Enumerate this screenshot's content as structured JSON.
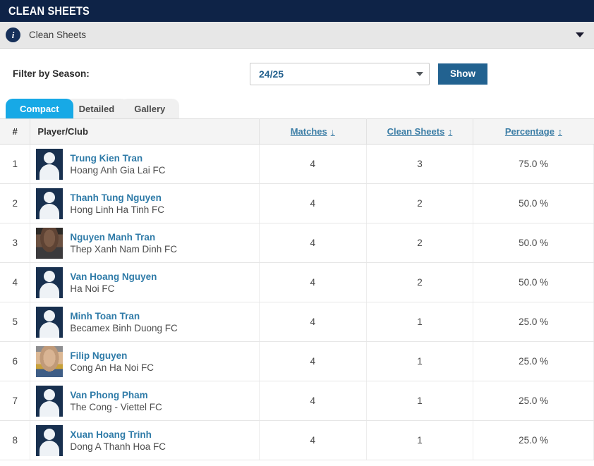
{
  "titlebar": {
    "title": "Clean Sheets"
  },
  "infobar": {
    "label": "Clean Sheets",
    "info_icon": "info-icon",
    "chevron_icon": "chevron-down-icon"
  },
  "filter": {
    "label": "Filter by Season:",
    "season_value": "24/25",
    "season_options": [
      "24/25"
    ],
    "show_label": "Show",
    "caret_icon": "caret-down-icon",
    "button_color": "#226290"
  },
  "tabs": [
    {
      "label": "Compact",
      "active": true
    },
    {
      "label": "Detailed",
      "active": false
    },
    {
      "label": "Gallery",
      "active": false
    }
  ],
  "tab_active_color": "#17a9e6",
  "table": {
    "columns": [
      {
        "key": "rank",
        "label": "#",
        "sortable": false,
        "sort_icon": ""
      },
      {
        "key": "player",
        "label": "Player/Club",
        "sortable": false,
        "sort_icon": ""
      },
      {
        "key": "matches",
        "label": "Matches",
        "sortable": true,
        "sort_icon": "arrow-down-icon",
        "glyph": "↓"
      },
      {
        "key": "clean_sheets",
        "label": "Clean Sheets",
        "sortable": true,
        "sort_icon": "arrow-up-down-icon",
        "glyph": "↕"
      },
      {
        "key": "percentage",
        "label": "Percentage",
        "sortable": true,
        "sort_icon": "arrow-up-down-icon",
        "glyph": "↕"
      }
    ],
    "rows": [
      {
        "rank": "1",
        "player": "Trung Kien Tran",
        "club": "Hoang Anh Gia Lai FC",
        "matches": "4",
        "clean_sheets": "3",
        "percentage": "75.0 %",
        "avatar": "placeholder"
      },
      {
        "rank": "2",
        "player": "Thanh Tung Nguyen",
        "club": "Hong Linh Ha Tinh FC",
        "matches": "4",
        "clean_sheets": "2",
        "percentage": "50.0 %",
        "avatar": "placeholder"
      },
      {
        "rank": "3",
        "player": "Nguyen Manh Tran",
        "club": "Thep Xanh Nam Dinh FC",
        "matches": "4",
        "clean_sheets": "2",
        "percentage": "50.0 %",
        "avatar": "photo-dark"
      },
      {
        "rank": "4",
        "player": "Van Hoang Nguyen",
        "club": "Ha Noi FC",
        "matches": "4",
        "clean_sheets": "2",
        "percentage": "50.0 %",
        "avatar": "placeholder"
      },
      {
        "rank": "5",
        "player": "Minh Toan Tran",
        "club": "Becamex Binh Duong FC",
        "matches": "4",
        "clean_sheets": "1",
        "percentage": "25.0 %",
        "avatar": "placeholder"
      },
      {
        "rank": "6",
        "player": "Filip Nguyen",
        "club": "Cong An Ha Noi FC",
        "matches": "4",
        "clean_sheets": "1",
        "percentage": "25.0 %",
        "avatar": "photo-light"
      },
      {
        "rank": "7",
        "player": "Van Phong Pham",
        "club": "The Cong - Viettel FC",
        "matches": "4",
        "clean_sheets": "1",
        "percentage": "25.0 %",
        "avatar": "placeholder"
      },
      {
        "rank": "8",
        "player": "Xuan Hoang Trinh",
        "club": "Dong A Thanh Hoa FC",
        "matches": "4",
        "clean_sheets": "1",
        "percentage": "25.0 %",
        "avatar": "placeholder"
      }
    ]
  }
}
